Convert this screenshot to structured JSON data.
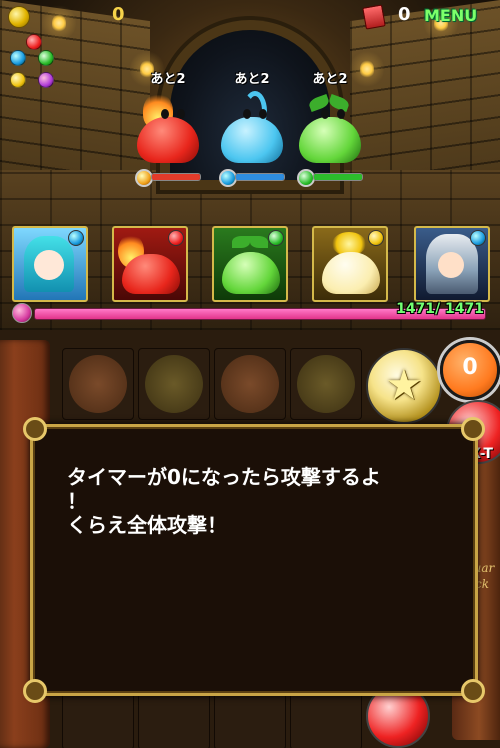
{
  "hud": {
    "coins": "0",
    "books": "0",
    "menu_label": "MENU"
  },
  "enemies": [
    {
      "name": "fire-slime",
      "turn_label": "あと2",
      "color": "#e8261c",
      "hp_color": "#e23b2a"
    },
    {
      "name": "water-slime",
      "turn_label": "あと2",
      "color": "#4cc6f0",
      "hp_color": "#2e8de0"
    },
    {
      "name": "wood-slime",
      "turn_label": "あと2",
      "color": "#63d63a",
      "hp_color": "#2cbd2c"
    }
  ],
  "team": [
    {
      "name": "blue-haired-girl",
      "attr": "blue"
    },
    {
      "name": "fire-slime-card",
      "attr": "red"
    },
    {
      "name": "wood-slime-card",
      "attr": "green"
    },
    {
      "name": "light-slime-card",
      "attr": "yellow"
    },
    {
      "name": "armored-knight",
      "attr": "blue"
    }
  ],
  "player_hp": {
    "text": "1471/ 1471",
    "fraction": 1.0
  },
  "timer": {
    "value": "0",
    "label": "X-T"
  },
  "dialog": {
    "lines": [
      "タイマーが0になったら攻撃するよ",
      "！",
      "くらえ全体攻撃！"
    ]
  },
  "book_spine": "Jaguar Flick",
  "colors": {
    "gold_border": "#c9a546",
    "hp_green": "#73ff73",
    "menu_green": "#7cff6a"
  }
}
